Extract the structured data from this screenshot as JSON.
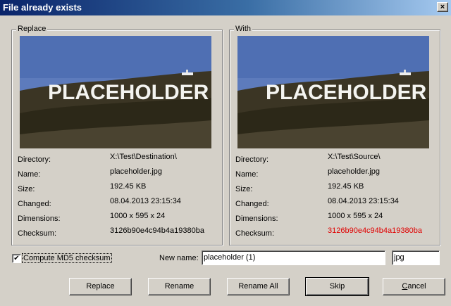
{
  "window": {
    "title": "File already exists",
    "close_glyph": "×"
  },
  "replace": {
    "label": "Replace",
    "image_text": "PLACEHOLDER",
    "properties": [
      {
        "label": "Directory:",
        "value": "X:\\Test\\Destination\\"
      },
      {
        "label": "Name:",
        "value": "placeholder.jpg"
      },
      {
        "label": "Size:",
        "value": "192.45 KB"
      },
      {
        "label": "Changed:",
        "value": "08.04.2013 23:15:34"
      },
      {
        "label": "Dimensions:",
        "value": "1000 x 595 x 24"
      },
      {
        "label": "Checksum:",
        "value": "3126b90e4c94b4a19380ba"
      }
    ]
  },
  "with": {
    "label": "With",
    "image_text": "PLACEHOLDER",
    "properties": [
      {
        "label": "Directory:",
        "value": "X:\\Test\\Source\\"
      },
      {
        "label": "Name:",
        "value": "placeholder.jpg"
      },
      {
        "label": "Size:",
        "value": "192.45 KB"
      },
      {
        "label": "Changed:",
        "value": "08.04.2013 23:15:34"
      },
      {
        "label": "Dimensions:",
        "value": "1000 x 595 x 24"
      },
      {
        "label": "Checksum:",
        "value": "3126b90e4c94b4a19380ba",
        "highlight_color": "#e00000"
      }
    ]
  },
  "options": {
    "compute_md5_label": "Compute MD5 checksum",
    "compute_md5_checked": true,
    "check_glyph": "✔",
    "new_name_label": "New name:",
    "new_name_value": "placeholder (1)",
    "extension_value": "jpg"
  },
  "buttons": {
    "replace": "Replace",
    "rename": "Rename",
    "rename_all": "Rename All",
    "skip": "Skip",
    "cancel_first": "C",
    "cancel_rest": "ancel"
  }
}
